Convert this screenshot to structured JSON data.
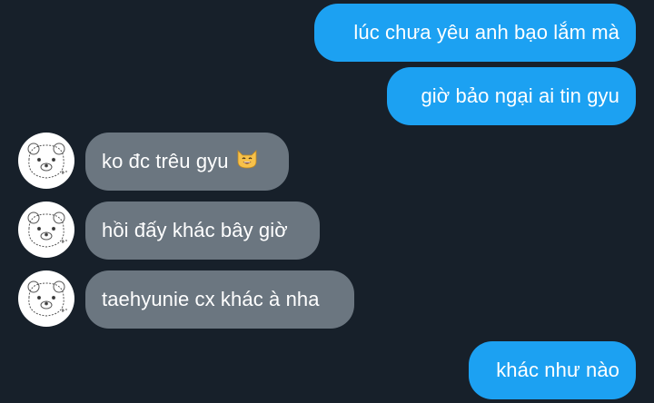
{
  "chat": {
    "messages": [
      {
        "direction": "outgoing",
        "text": "lúc chưa yêu anh bạo lắm mà"
      },
      {
        "direction": "outgoing",
        "text": "giờ bảo ngại ai tin gyu"
      },
      {
        "direction": "incoming",
        "text": "ko đc trêu gyu",
        "emoji": "grinning-cat-emoji"
      },
      {
        "direction": "incoming",
        "text": "hồi đấy khác bây giờ"
      },
      {
        "direction": "incoming",
        "text": "taehyunie cx khác à nha"
      },
      {
        "direction": "outgoing",
        "text": "khác như nào"
      }
    ],
    "avatar_icon": "bear-sketch-avatar",
    "colors": {
      "background": "#17202a",
      "outgoing_bubble": "#1ca1f2",
      "incoming_bubble": "#6b7680",
      "bubble_text": "#ffffff"
    }
  }
}
